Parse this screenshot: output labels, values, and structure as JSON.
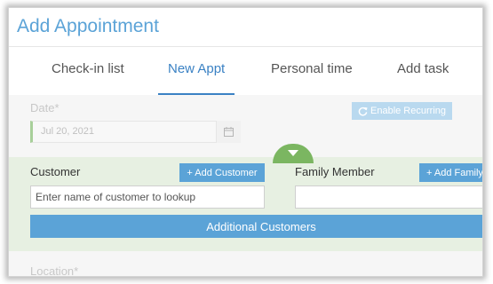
{
  "header": {
    "title": "Add Appointment"
  },
  "tabs": [
    {
      "label": "Check-in list"
    },
    {
      "label": "New Appt"
    },
    {
      "label": "Personal time"
    },
    {
      "label": "Add task"
    }
  ],
  "active_tab": "New Appt",
  "form": {
    "date_label": "Date*",
    "date_value": "Jul 20, 2021",
    "enable_recurring_label": "Enable Recurring",
    "customer_label": "Customer",
    "add_customer_label": "+ Add Customer",
    "customer_placeholder": "Enter name of customer to lookup",
    "family_member_label": "Family Member",
    "add_family_label": "+ Add Family",
    "additional_customers_label": "Additional Customers",
    "location_label": "Location*"
  },
  "icons": {
    "calendar": "calendar-icon",
    "refresh": "refresh-icon",
    "collapse": "triangle-down-icon"
  },
  "colors": {
    "accent": "#5ba3d7",
    "active_tab": "#3b82c4",
    "green": "#7bb661",
    "panel_bg": "#e7f0e2"
  }
}
